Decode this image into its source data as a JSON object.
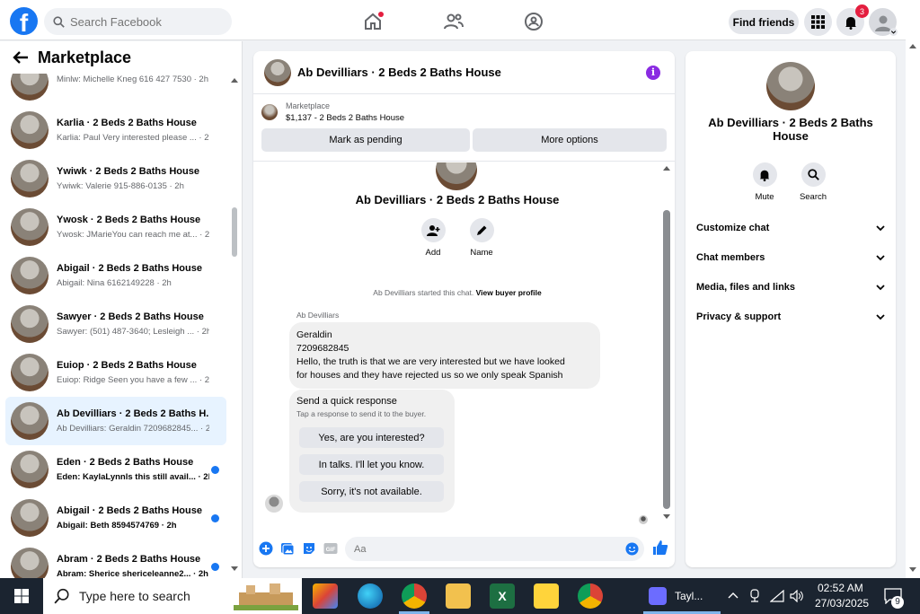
{
  "topbar": {
    "logo_letter": "f",
    "search_placeholder": "Search Facebook",
    "find_friends_label": "Find friends",
    "notifications_count": "3"
  },
  "left_panel": {
    "title": "Marketplace",
    "conversations": [
      {
        "name": "",
        "preview": "Minlw: Michelle Kneg 616 427 7530 · 2h",
        "unread": false,
        "active": false
      },
      {
        "name": "Karlia · 2 Beds 2 Baths House",
        "preview": "Karlia: Paul Very interested please ... · 2h",
        "unread": false,
        "active": false
      },
      {
        "name": "Ywiwk · 2 Beds 2 Baths House",
        "preview": "Ywiwk: Valerie 915-886-0135 · 2h",
        "unread": false,
        "active": false
      },
      {
        "name": "Ywosk · 2 Beds 2 Baths House",
        "preview": "Ywosk: JMarieYou can reach me at... · 2h",
        "unread": false,
        "active": false
      },
      {
        "name": "Abigail · 2 Beds 2 Baths House",
        "preview": "Abigail: Nina 6162149228 · 2h",
        "unread": false,
        "active": false
      },
      {
        "name": "Sawyer · 2 Beds 2 Baths House",
        "preview": "Sawyer: (501) 487-3640; Lesleigh ... · 2h",
        "unread": false,
        "active": false
      },
      {
        "name": "Euiop · 2 Beds 2 Baths House",
        "preview": "Euiop: Ridge Seen you have a few ... · 2h",
        "unread": false,
        "active": false
      },
      {
        "name": "Ab Devilliars · 2 Beds 2 Baths H...",
        "preview": "Ab Devilliars: Geraldin 7209682845... · 2h",
        "unread": false,
        "active": true
      },
      {
        "name": "Eden · 2 Beds 2 Baths House",
        "preview": "Eden: KaylaLynnls this still avail... · 2h",
        "unread": true,
        "active": false
      },
      {
        "name": "Abigail · 2 Beds 2 Baths House",
        "preview": "Abigail: Beth 8594574769 · 2h",
        "unread": true,
        "active": false
      },
      {
        "name": "Abram · 2 Beds 2 Baths House",
        "preview": "Abram: Sherice shericeleanne2... · 2h",
        "unread": true,
        "active": false
      }
    ]
  },
  "chat": {
    "header_title": "Ab Devilliars · 2 Beds 2 Baths House",
    "info_glyph": "i",
    "marketplace_label": "Marketplace",
    "listing_price": "$1,137 - 2 Beds 2 Baths House",
    "mark_pending_label": "Mark as pending",
    "more_options_label": "More options",
    "profile_name": "Ab Devilliars · 2 Beds 2 Baths House",
    "add_label": "Add",
    "name_label": "Name",
    "started_text": "Ab Devilliars started this chat.",
    "view_profile_link": "View buyer profile",
    "sender_name": "Ab Devilliars",
    "message_lines": [
      "Geraldin",
      "7209682845",
      "Hello, the truth is that we are very interested but we have looked",
      "for houses and they have rejected us so we only speak Spanish"
    ],
    "quick_title": "Send a quick response",
    "quick_subtitle": "Tap a response to send it to the buyer.",
    "quick_responses": [
      "Yes, are you interested?",
      "In talks. I'll let you know.",
      "Sorry, it's not available."
    ],
    "composer_placeholder": "Aa"
  },
  "details": {
    "name": "Ab Devilliars · 2 Beds 2 Baths House",
    "mute_label": "Mute",
    "search_label": "Search",
    "sections": [
      "Customize chat",
      "Chat members",
      "Media, files and links",
      "Privacy & support"
    ]
  },
  "taskbar": {
    "search_placeholder": "Type here to search",
    "running_app_label": "Tayl...",
    "time": "02:52 AM",
    "date": "27/03/2025",
    "notification_count": "9"
  },
  "colors": {
    "brand": "#1877f2",
    "unread_dot": "#1877f2",
    "active_row": "#e7f3ff",
    "info_purple": "#8a2be2",
    "badge_red": "#e41e3f"
  }
}
